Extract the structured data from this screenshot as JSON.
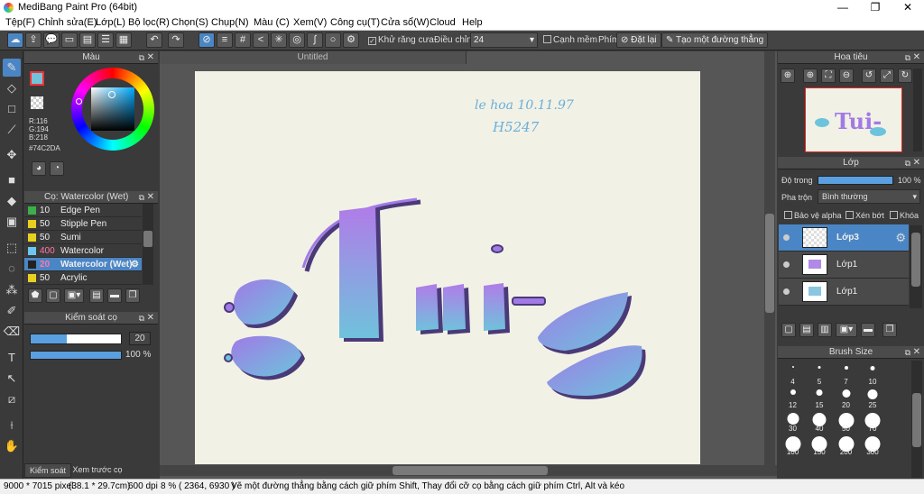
{
  "window": {
    "title": "MediBang Paint Pro (64bit)",
    "min": "—",
    "max": "❐",
    "close": "✕"
  },
  "menu": [
    "Tệp(F)",
    "Chỉnh sửa(E)",
    "Lớp(L)",
    "Bộ lọc(R)",
    "Chọn(S)",
    "Chụp(N)",
    "Màu (C)",
    "Xem(V)",
    "Công cụ(T)",
    "Cửa sổ(W)",
    "Cloud",
    "Help"
  ],
  "toolbar": {
    "antialias": "Khử răng cưa",
    "correction_label": "Điều chỉnh",
    "correction_value": "24",
    "snap_edge": "Cạnh mềm",
    "key_label": "Phím",
    "reset": "Đặt lại",
    "straight_line": "Tạo một đường thẳng"
  },
  "color_panel": {
    "title": "Màu",
    "r": "R:116",
    "g": "G:194",
    "b": "B:218",
    "hex": "#74C2DA",
    "current": "#74C2DA"
  },
  "brush_panel": {
    "title": "Cọ: Watercolor (Wet)",
    "items": [
      {
        "size": "10",
        "name": "Edge Pen",
        "color": "#3bb04a"
      },
      {
        "size": "50",
        "name": "Stipple Pen",
        "color": "#e8d020"
      },
      {
        "size": "50",
        "name": "Sumi",
        "color": "#e8d020"
      },
      {
        "size": "400",
        "name": "Watercolor",
        "color": "#6cc6f0"
      },
      {
        "size": "20",
        "name": "Watercolor (Wet)",
        "color": "#222222"
      },
      {
        "size": "50",
        "name": "Acrylic",
        "color": "#e8d020"
      }
    ]
  },
  "brush_control": {
    "title": "Kiểm soát cọ",
    "size": "20",
    "opacity": "100 %",
    "size_fraction": 0.4,
    "opacity_fraction": 1.0
  },
  "bottom_tabs": [
    "Kiểm soát cọ",
    "Xem trước cọ"
  ],
  "canvas": {
    "tab": "Untitled",
    "handwriting_1": "le hoa 10.11.97",
    "handwriting_2": "H5247",
    "art_text": "Tui-"
  },
  "navigator": {
    "title": "Hoa tiêu"
  },
  "layer_panel": {
    "title": "Lớp",
    "opacity_label": "Độ trong",
    "opacity_value": "100 %",
    "opacity_fraction": 1.0,
    "blend_label": "Pha trộn",
    "blend_value": "Bình thường",
    "protect_alpha": "Bảo vệ alpha",
    "clipping": "Xén bớt",
    "lock": "Khóa",
    "layers": [
      "Lớp3",
      "Lớp1",
      "Lớp1"
    ]
  },
  "brush_size_panel": {
    "title": "Brush Size",
    "sizes": [
      "4",
      "5",
      "7",
      "10",
      "12",
      "15",
      "20",
      "25",
      "30",
      "40",
      "50",
      "70",
      "100",
      "150",
      "200",
      "300"
    ]
  },
  "status": {
    "dimensions": "9000 * 7015 pixel",
    "physical": "(38.1 * 29.7cm)",
    "dpi": "600 dpi",
    "zoom": "8 %",
    "cursor": "( 2364, 6930 )",
    "hint": "Vẽ một đường thẳng bằng cách giữ phím Shift, Thay đổi cỡ cọ bằng cách giữ phím Ctrl, Alt và kéo"
  }
}
